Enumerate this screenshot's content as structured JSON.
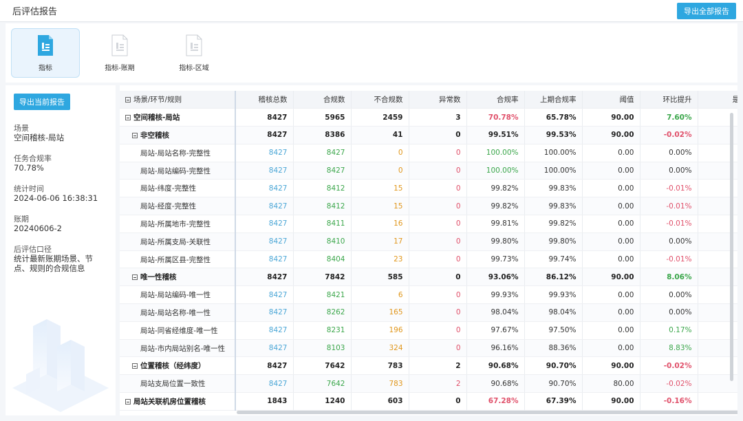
{
  "header": {
    "title": "后评估报告",
    "export_all": "导出全部报告"
  },
  "tabs": [
    {
      "label": "指标",
      "active": true
    },
    {
      "label": "指标-账期",
      "active": false
    },
    {
      "label": "指标-区域",
      "active": false
    }
  ],
  "left": {
    "export_current": "导出当前报告",
    "info": [
      {
        "label": "场景",
        "value": "空间稽核-局站"
      },
      {
        "label": "任务合规率",
        "value": "70.78%"
      },
      {
        "label": "统计时间",
        "value": "2024-06-06 16:38:31"
      },
      {
        "label": "账期",
        "value": "20240606-2"
      },
      {
        "label": "后评估口径",
        "value": "统计最新账期场景、节点、规则的合规信息"
      }
    ]
  },
  "table": {
    "columns": [
      "场景/环节/规则",
      "稽核总数",
      "合规数",
      "不合规数",
      "异常数",
      "合规率",
      "上期合规率",
      "阈值",
      "环比提升",
      "是否"
    ],
    "rows": [
      {
        "level": 0,
        "name": "空间稽核-局站",
        "total": "8427",
        "ok": "5965",
        "bad": "2459",
        "abn": "3",
        "rate": "70.78%",
        "rate_color": "red",
        "prev": "65.78%",
        "threshold": "90.00",
        "delta": "7.60%",
        "delta_color": "green"
      },
      {
        "level": 1,
        "name": "非空稽核",
        "total": "8427",
        "ok": "8386",
        "bad": "41",
        "abn": "0",
        "rate": "99.51%",
        "rate_color": "",
        "prev": "99.53%",
        "threshold": "90.00",
        "delta": "-0.02%",
        "delta_color": "red"
      },
      {
        "level": 2,
        "name": "局站-局站名称-完整性",
        "total": "8427",
        "ok": "8427",
        "bad": "0",
        "abn": "0",
        "rate": "100.00%",
        "rate_color": "green",
        "prev": "100.00%",
        "threshold": "0.00",
        "delta": "0.00%",
        "delta_color": ""
      },
      {
        "level": 2,
        "name": "局站-局站编码-完整性",
        "total": "8427",
        "ok": "8427",
        "bad": "0",
        "abn": "0",
        "rate": "100.00%",
        "rate_color": "green",
        "prev": "100.00%",
        "threshold": "0.00",
        "delta": "0.00%",
        "delta_color": ""
      },
      {
        "level": 2,
        "name": "局站-纬度-完整性",
        "total": "8427",
        "ok": "8412",
        "bad": "15",
        "abn": "0",
        "rate": "99.82%",
        "rate_color": "",
        "prev": "99.83%",
        "threshold": "0.00",
        "delta": "-0.01%",
        "delta_color": "red"
      },
      {
        "level": 2,
        "name": "局站-经度-完整性",
        "total": "8427",
        "ok": "8412",
        "bad": "15",
        "abn": "0",
        "rate": "99.82%",
        "rate_color": "",
        "prev": "99.83%",
        "threshold": "0.00",
        "delta": "-0.01%",
        "delta_color": "red"
      },
      {
        "level": 2,
        "name": "局站-所属地市-完整性",
        "total": "8427",
        "ok": "8411",
        "bad": "16",
        "abn": "0",
        "rate": "99.81%",
        "rate_color": "",
        "prev": "99.82%",
        "threshold": "0.00",
        "delta": "-0.01%",
        "delta_color": "red"
      },
      {
        "level": 2,
        "name": "局站-所属支局-关联性",
        "total": "8427",
        "ok": "8410",
        "bad": "17",
        "abn": "0",
        "rate": "99.80%",
        "rate_color": "",
        "prev": "99.80%",
        "threshold": "0.00",
        "delta": "0.00%",
        "delta_color": ""
      },
      {
        "level": 2,
        "name": "局站-所属区县-完整性",
        "total": "8427",
        "ok": "8404",
        "bad": "23",
        "abn": "0",
        "rate": "99.73%",
        "rate_color": "",
        "prev": "99.74%",
        "threshold": "0.00",
        "delta": "-0.01%",
        "delta_color": "red"
      },
      {
        "level": 1,
        "name": "唯一性稽核",
        "total": "8427",
        "ok": "7842",
        "bad": "585",
        "abn": "0",
        "rate": "93.06%",
        "rate_color": "",
        "prev": "86.12%",
        "threshold": "90.00",
        "delta": "8.06%",
        "delta_color": "green"
      },
      {
        "level": 2,
        "name": "局站-局站编码-唯一性",
        "total": "8427",
        "ok": "8421",
        "bad": "6",
        "abn": "0",
        "rate": "99.93%",
        "rate_color": "",
        "prev": "99.93%",
        "threshold": "0.00",
        "delta": "0.00%",
        "delta_color": ""
      },
      {
        "level": 2,
        "name": "局站-局站名称-唯一性",
        "total": "8427",
        "ok": "8262",
        "bad": "165",
        "abn": "0",
        "rate": "98.04%",
        "rate_color": "",
        "prev": "98.04%",
        "threshold": "0.00",
        "delta": "0.00%",
        "delta_color": ""
      },
      {
        "level": 2,
        "name": "局站-同省经维度-唯一性",
        "total": "8427",
        "ok": "8231",
        "bad": "196",
        "abn": "0",
        "rate": "97.67%",
        "rate_color": "",
        "prev": "97.50%",
        "threshold": "0.00",
        "delta": "0.17%",
        "delta_color": "green"
      },
      {
        "level": 2,
        "name": "局站-市内局站别名-唯一性",
        "total": "8427",
        "ok": "8103",
        "bad": "324",
        "abn": "0",
        "rate": "96.16%",
        "rate_color": "",
        "prev": "88.36%",
        "threshold": "0.00",
        "delta": "8.83%",
        "delta_color": "green"
      },
      {
        "level": 1,
        "name": "位置稽核（经纬度）",
        "total": "8427",
        "ok": "7642",
        "bad": "783",
        "abn": "2",
        "rate": "90.68%",
        "rate_color": "",
        "prev": "90.70%",
        "threshold": "90.00",
        "delta": "-0.02%",
        "delta_color": "red"
      },
      {
        "level": 2,
        "name": "局站支局位置一致性",
        "total": "8427",
        "ok": "7642",
        "bad": "783",
        "abn": "2",
        "rate": "90.68%",
        "rate_color": "",
        "prev": "90.70%",
        "threshold": "80.00",
        "delta": "-0.02%",
        "delta_color": "red"
      },
      {
        "level": 0,
        "name": "局站关联机房位置稽核",
        "total": "1843",
        "ok": "1240",
        "bad": "603",
        "abn": "0",
        "rate": "67.28%",
        "rate_color": "red",
        "prev": "67.39%",
        "threshold": "90.00",
        "delta": "-0.16%",
        "delta_color": "red"
      }
    ]
  }
}
